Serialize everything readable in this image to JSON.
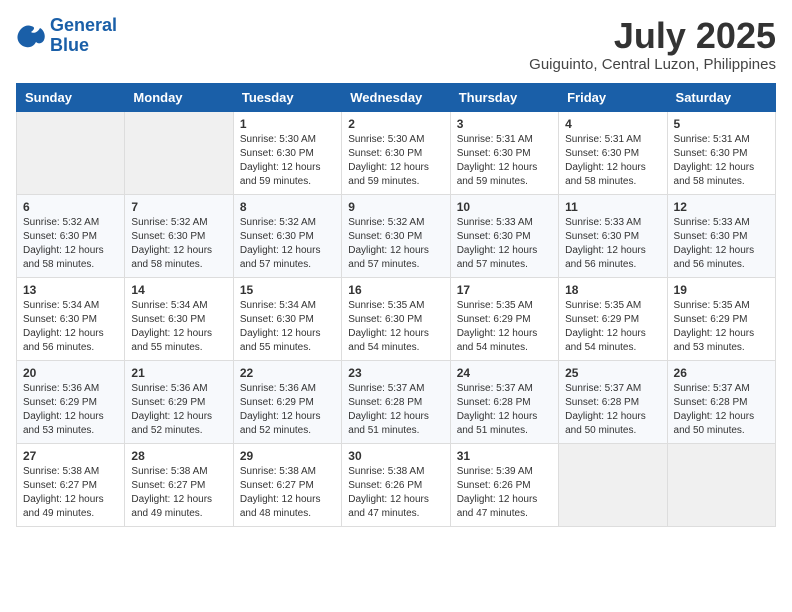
{
  "header": {
    "logo_line1": "General",
    "logo_line2": "Blue",
    "month_title": "July 2025",
    "location": "Guiguinto, Central Luzon, Philippines"
  },
  "weekdays": [
    "Sunday",
    "Monday",
    "Tuesday",
    "Wednesday",
    "Thursday",
    "Friday",
    "Saturday"
  ],
  "weeks": [
    [
      {
        "day": "",
        "info": ""
      },
      {
        "day": "",
        "info": ""
      },
      {
        "day": "1",
        "info": "Sunrise: 5:30 AM\nSunset: 6:30 PM\nDaylight: 12 hours and 59 minutes."
      },
      {
        "day": "2",
        "info": "Sunrise: 5:30 AM\nSunset: 6:30 PM\nDaylight: 12 hours and 59 minutes."
      },
      {
        "day": "3",
        "info": "Sunrise: 5:31 AM\nSunset: 6:30 PM\nDaylight: 12 hours and 59 minutes."
      },
      {
        "day": "4",
        "info": "Sunrise: 5:31 AM\nSunset: 6:30 PM\nDaylight: 12 hours and 58 minutes."
      },
      {
        "day": "5",
        "info": "Sunrise: 5:31 AM\nSunset: 6:30 PM\nDaylight: 12 hours and 58 minutes."
      }
    ],
    [
      {
        "day": "6",
        "info": "Sunrise: 5:32 AM\nSunset: 6:30 PM\nDaylight: 12 hours and 58 minutes."
      },
      {
        "day": "7",
        "info": "Sunrise: 5:32 AM\nSunset: 6:30 PM\nDaylight: 12 hours and 58 minutes."
      },
      {
        "day": "8",
        "info": "Sunrise: 5:32 AM\nSunset: 6:30 PM\nDaylight: 12 hours and 57 minutes."
      },
      {
        "day": "9",
        "info": "Sunrise: 5:32 AM\nSunset: 6:30 PM\nDaylight: 12 hours and 57 minutes."
      },
      {
        "day": "10",
        "info": "Sunrise: 5:33 AM\nSunset: 6:30 PM\nDaylight: 12 hours and 57 minutes."
      },
      {
        "day": "11",
        "info": "Sunrise: 5:33 AM\nSunset: 6:30 PM\nDaylight: 12 hours and 56 minutes."
      },
      {
        "day": "12",
        "info": "Sunrise: 5:33 AM\nSunset: 6:30 PM\nDaylight: 12 hours and 56 minutes."
      }
    ],
    [
      {
        "day": "13",
        "info": "Sunrise: 5:34 AM\nSunset: 6:30 PM\nDaylight: 12 hours and 56 minutes."
      },
      {
        "day": "14",
        "info": "Sunrise: 5:34 AM\nSunset: 6:30 PM\nDaylight: 12 hours and 55 minutes."
      },
      {
        "day": "15",
        "info": "Sunrise: 5:34 AM\nSunset: 6:30 PM\nDaylight: 12 hours and 55 minutes."
      },
      {
        "day": "16",
        "info": "Sunrise: 5:35 AM\nSunset: 6:30 PM\nDaylight: 12 hours and 54 minutes."
      },
      {
        "day": "17",
        "info": "Sunrise: 5:35 AM\nSunset: 6:29 PM\nDaylight: 12 hours and 54 minutes."
      },
      {
        "day": "18",
        "info": "Sunrise: 5:35 AM\nSunset: 6:29 PM\nDaylight: 12 hours and 54 minutes."
      },
      {
        "day": "19",
        "info": "Sunrise: 5:35 AM\nSunset: 6:29 PM\nDaylight: 12 hours and 53 minutes."
      }
    ],
    [
      {
        "day": "20",
        "info": "Sunrise: 5:36 AM\nSunset: 6:29 PM\nDaylight: 12 hours and 53 minutes."
      },
      {
        "day": "21",
        "info": "Sunrise: 5:36 AM\nSunset: 6:29 PM\nDaylight: 12 hours and 52 minutes."
      },
      {
        "day": "22",
        "info": "Sunrise: 5:36 AM\nSunset: 6:29 PM\nDaylight: 12 hours and 52 minutes."
      },
      {
        "day": "23",
        "info": "Sunrise: 5:37 AM\nSunset: 6:28 PM\nDaylight: 12 hours and 51 minutes."
      },
      {
        "day": "24",
        "info": "Sunrise: 5:37 AM\nSunset: 6:28 PM\nDaylight: 12 hours and 51 minutes."
      },
      {
        "day": "25",
        "info": "Sunrise: 5:37 AM\nSunset: 6:28 PM\nDaylight: 12 hours and 50 minutes."
      },
      {
        "day": "26",
        "info": "Sunrise: 5:37 AM\nSunset: 6:28 PM\nDaylight: 12 hours and 50 minutes."
      }
    ],
    [
      {
        "day": "27",
        "info": "Sunrise: 5:38 AM\nSunset: 6:27 PM\nDaylight: 12 hours and 49 minutes."
      },
      {
        "day": "28",
        "info": "Sunrise: 5:38 AM\nSunset: 6:27 PM\nDaylight: 12 hours and 49 minutes."
      },
      {
        "day": "29",
        "info": "Sunrise: 5:38 AM\nSunset: 6:27 PM\nDaylight: 12 hours and 48 minutes."
      },
      {
        "day": "30",
        "info": "Sunrise: 5:38 AM\nSunset: 6:26 PM\nDaylight: 12 hours and 47 minutes."
      },
      {
        "day": "31",
        "info": "Sunrise: 5:39 AM\nSunset: 6:26 PM\nDaylight: 12 hours and 47 minutes."
      },
      {
        "day": "",
        "info": ""
      },
      {
        "day": "",
        "info": ""
      }
    ]
  ]
}
